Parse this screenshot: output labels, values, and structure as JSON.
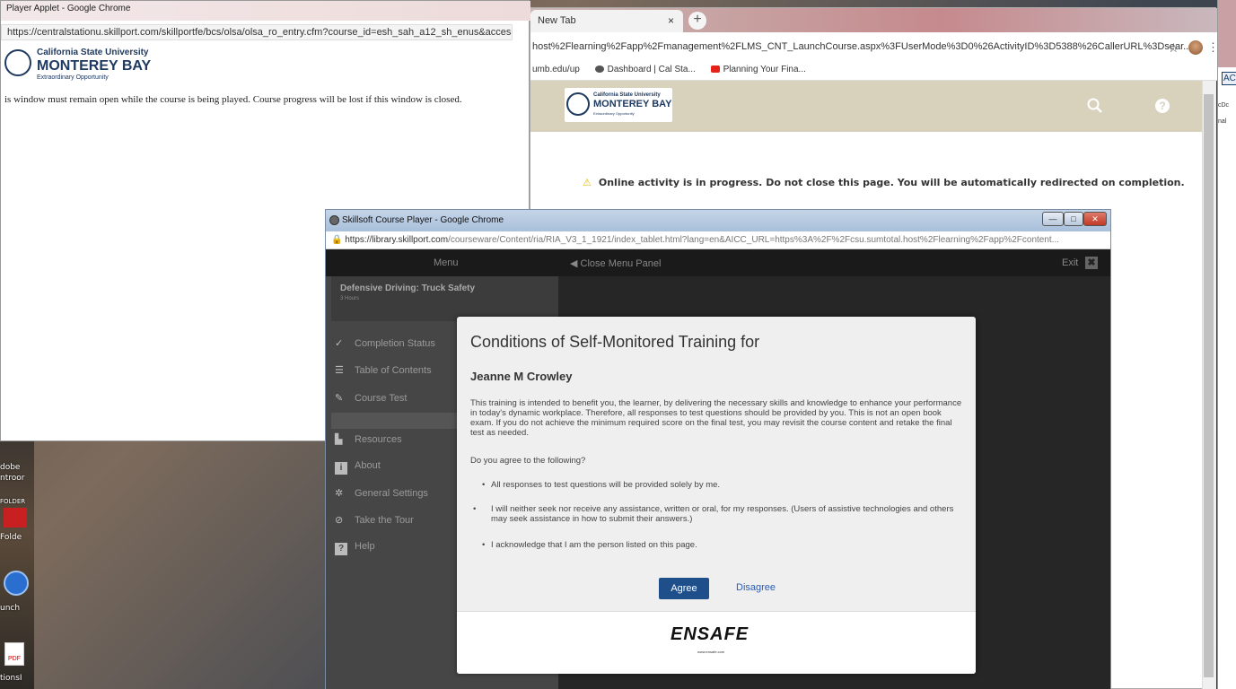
{
  "window_player_applet": {
    "title": "Player Applet - Google Chrome",
    "url": "https://centralstationu.skillport.com/skillportfe/bcs/olsa/olsa_ro_entry.cfm?course_id=esh_sah_a12_sh_enus&access_...",
    "logo": {
      "line1": "California State University",
      "line2": "MONTEREY BAY",
      "line3": "Extraordinary Opportunity"
    },
    "message": "is window must remain open while the course is being played. Course progress will be lost if this window is closed."
  },
  "window_new_tab": {
    "tab_label": "New Tab",
    "tab_close": "×",
    "new_tab": "+",
    "url": "host%2Flearning%2Fapp%2Fmanagement%2FLMS_CNT_LaunchCourse.aspx%3FUserMode%3D0%26ActivityID%3D5388%26CallerURL%3Dsear...",
    "star": "☆",
    "menu": "⋮",
    "bookmarks": [
      {
        "label": "umb.edu/up",
        "icon": "none"
      },
      {
        "label": "Dashboard | Cal Sta...",
        "icon": "dashboard-icon"
      },
      {
        "label": "Planning Your Fina...",
        "icon": "youtube-icon"
      }
    ],
    "logo": {
      "line1": "California State University",
      "line2": "MONTEREY BAY",
      "line3": "Extraordinary Opportunity"
    },
    "search_icon": "search-icon",
    "help_label": "?",
    "notice": "Online activity is in progress. Do not close this page. You will be automatically redirected on completion.",
    "warning_glyph": "⚠"
  },
  "window_far_right": {
    "acc_label": "AC",
    "texts": [
      "cDc",
      "nal"
    ]
  },
  "desktop": {
    "icons": [
      "dobe",
      "ntroor",
      "FOLDER",
      "Folde",
      "unch",
      "PDF",
      "tionsI"
    ]
  },
  "window_skillsoft": {
    "title": "Skillsoft Course Player - Google Chrome",
    "url_host": "https://library.skillport.com",
    "url_path": "/courseware/Content/ria/RIA_V3_1_1921/index_tablet.html?lang=en&AICC_URL=https%3A%2F%2Fcsu.sumtotal.host%2Flearning%2Fapp%2Fcontent...",
    "menu_label": "Menu",
    "close_menu_panel": "◀ Close Menu Panel",
    "exit_label": "Exit",
    "exit_x": "✖",
    "controls": {
      "minimize": "—",
      "maximize": "□",
      "close": "✕"
    },
    "course": {
      "title": "Defensive Driving: Truck Safety",
      "hours": "3 Hours"
    },
    "menu_items": [
      {
        "label": "Completion Status",
        "icon": "completion-status-icon",
        "glyph": "✓"
      },
      {
        "label": "Table of Contents",
        "icon": "list-icon",
        "glyph": "☰"
      },
      {
        "label": "Course Test",
        "icon": "pencil-icon",
        "glyph": "✎"
      },
      {
        "label": "Resources",
        "icon": "resources-icon",
        "glyph": "▙"
      },
      {
        "label": "About",
        "icon": "info-icon",
        "glyph": "i"
      },
      {
        "label": "General Settings",
        "icon": "gear-icon",
        "glyph": "✲"
      },
      {
        "label": "Take the Tour",
        "icon": "tour-icon",
        "glyph": "⊘"
      },
      {
        "label": "Help",
        "icon": "help-icon",
        "glyph": "?"
      }
    ]
  },
  "dialog": {
    "title": "Conditions of Self-Monitored Training for",
    "learner_name": "Jeanne M Crowley",
    "paragraph": "This training is intended to benefit you, the learner, by delivering the necessary skills and knowledge to enhance your performance in today's dynamic workplace. Therefore, all responses to test questions should be provided by you. This is not an open book exam. If you do not achieve the minimum required score on the final test, you may revisit the course content and retake the final test as needed.",
    "question": "Do you agree to the following?",
    "bullets": [
      "All responses to test questions will be provided solely by me.",
      "I will neither seek nor receive any assistance, written or oral, for my responses. (Users of assistive technologies and others may seek assistance in how to submit their answers.)",
      "I acknowledge that I am the person listed on this page."
    ],
    "agree_label": "Agree",
    "disagree_label": "Disagree",
    "footer_logo": "ENSAFE",
    "footer_url": "www.ensafe.com"
  }
}
